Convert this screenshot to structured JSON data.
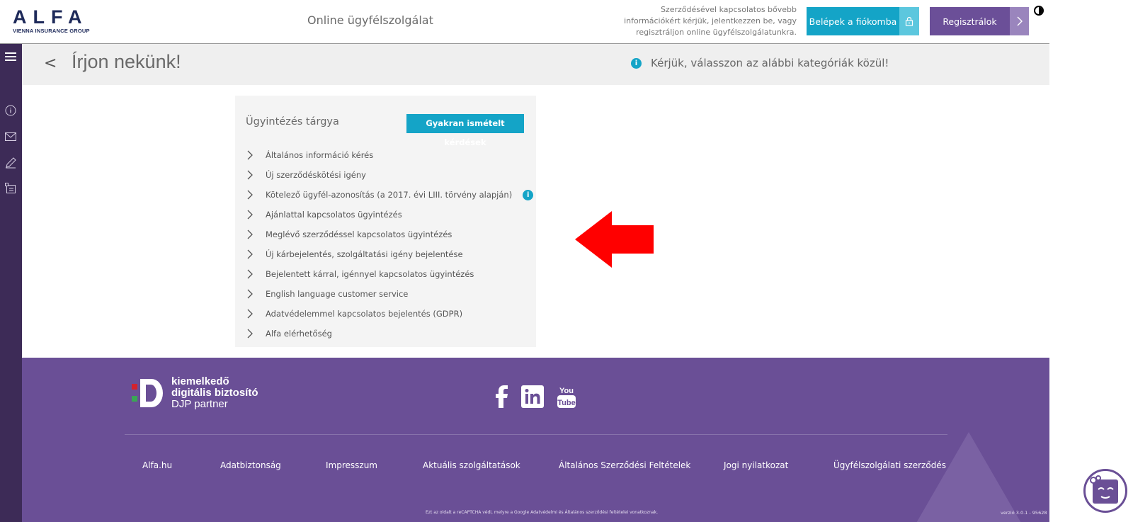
{
  "header": {
    "logo_text": "ALFA",
    "logo_subtitle": "VIENNA INSURANCE GROUP",
    "title": "Online ügyfélszolgálat",
    "note_lines": [
      "Szerződésével kapcsolatos bővebb",
      "információkért kérjük, jelentkezzen be, vagy",
      "regisztráljon online ügyfélszolgálatunkra."
    ],
    "login_label": "Belépek a fiókomba",
    "register_label": "Regisztrálok",
    "accent": "#14a4c7",
    "brand_purple": "#6b4f98"
  },
  "sidebar": {
    "icons": [
      "menu-icon",
      "info-icon",
      "mail-icon",
      "pencil-icon",
      "checklist-icon"
    ]
  },
  "titlebar": {
    "back_label": "<",
    "title": "Írjon nekünk!",
    "hint_icon": "i",
    "hint": "Kérjük, válasszon az alábbi kategóriák közül!"
  },
  "panel": {
    "title": "Ügyintézés tárgya",
    "faq_button": "Gyakran ismételt kérdések",
    "categories": [
      "Általános információ kérés",
      "Új szerződéskötési igény",
      "Kötelező ügyfél-azonosítás (a 2017. évi LIII. törvény alapján)",
      "Ajánlattal kapcsolatos ügyintézés",
      "Meglévő szerződéssel kapcsolatos ügyintézés",
      "Új kárbejelentés, szolgáltatási igény bejelentése",
      "Bejelentett kárral, igénnyel kapcsolatos ügyintézés",
      "English language customer service",
      "Adatvédelemmel kapcsolatos bejelentés (GDPR)",
      "Alfa elérhetőség"
    ],
    "info_icon_text": "i"
  },
  "overlay": {
    "arrow_color": "#ff0000"
  },
  "footer": {
    "djp_line1": "kiemelkedő",
    "djp_line2": "digitális biztosító",
    "djp_line3": "DJP partner",
    "social": [
      "facebook-icon",
      "linkedin-icon",
      "youtube-icon"
    ],
    "links": [
      "Alfa.hu",
      "Adatbiztonság",
      "Impresszum",
      "Aktuális szolgáltatások",
      "Általános Szerződési Feltételek",
      "Jogi nyilatkozat",
      "Ügyfélszolgálati szerződés"
    ],
    "recaptcha_note": "Ezt az oldalt a reCAPTCHA védi, melyre a Google Adatvédelmi és Általános szerződési feltételei vonatkoznak.",
    "version": "verzió 3.0.1 - 95628",
    "background": "#6a4f96"
  }
}
